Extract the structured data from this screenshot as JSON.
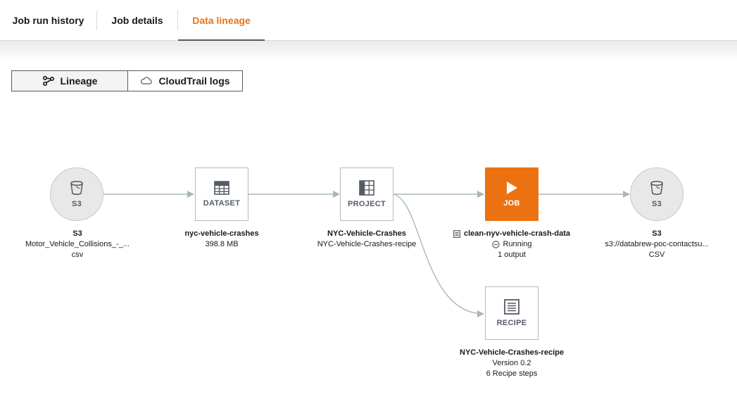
{
  "tabs": [
    {
      "label": "Job run history"
    },
    {
      "label": "Job details"
    },
    {
      "label": "Data lineage"
    }
  ],
  "active_tab": "Data lineage",
  "view_toggle": {
    "lineage": "Lineage",
    "cloudtrail": "CloudTrail logs",
    "selected": "Lineage"
  },
  "nodes": {
    "source_s3": {
      "type": "S3",
      "title": "S3",
      "subtitle": "Motor_Vehicle_Collisions_-_...",
      "detail": "csv"
    },
    "dataset": {
      "type": "DATASET",
      "title": "nyc-vehicle-crashes",
      "subtitle": "398.8 MB"
    },
    "project": {
      "type": "PROJECT",
      "title": "NYC-Vehicle-Crashes",
      "subtitle": "NYC-Vehicle-Crashes-recipe"
    },
    "job": {
      "type": "JOB",
      "title": "clean-nyv-vehicle-crash-data",
      "status": "Running",
      "outputs": "1 output"
    },
    "target_s3": {
      "type": "S3",
      "title": "S3",
      "subtitle": "s3://databrew-poc-contactsu...",
      "detail": "CSV"
    },
    "recipe": {
      "type": "RECIPE",
      "title": "NYC-Vehicle-Crashes-recipe",
      "version": "Version 0.2",
      "steps": "6 Recipe steps"
    }
  },
  "colors": {
    "accent": "#ec7211",
    "node_border": "#b8b8b8",
    "edge": "#aab7b8",
    "s3_fill": "#e8e8e8"
  },
  "icons": {
    "lineage": "lineage-icon",
    "cloudtrail": "cloud-icon",
    "s3": "bucket-icon",
    "dataset": "grid-icon",
    "project": "grid-icon",
    "job": "play-icon",
    "recipe": "document-icon",
    "status": "running-icon"
  }
}
